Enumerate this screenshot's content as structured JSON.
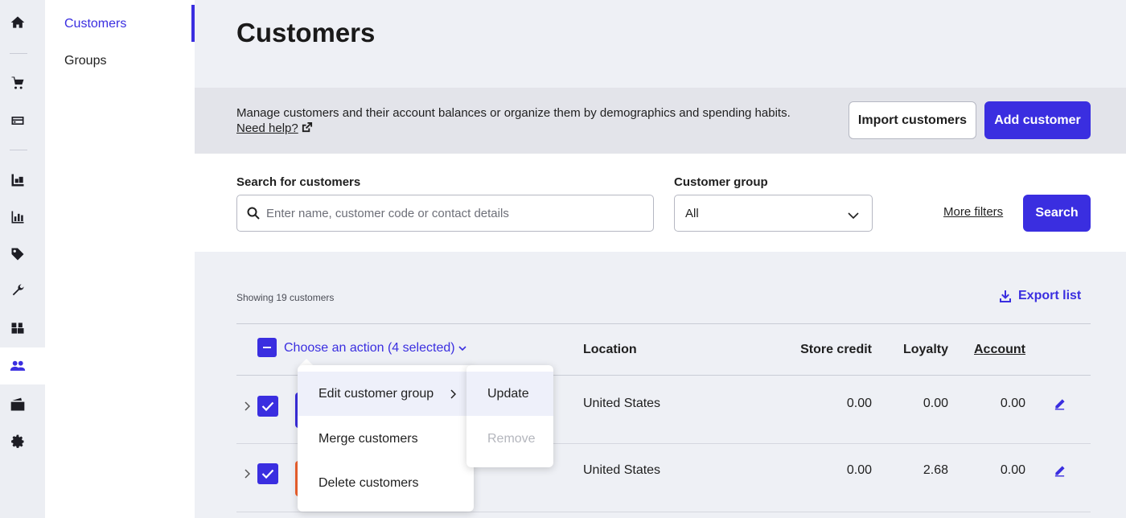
{
  "rail": {
    "icons": [
      "home-icon",
      "cart-icon",
      "register-icon",
      "inventory-icon",
      "reports-icon",
      "tag-icon",
      "wrench-icon",
      "products-icon",
      "customers-icon",
      "wallet-icon",
      "settings-icon"
    ],
    "active": "customers-icon"
  },
  "subnav": {
    "items": [
      {
        "label": "Customers",
        "active": true
      },
      {
        "label": "Groups",
        "active": false
      }
    ]
  },
  "page": {
    "title": "Customers"
  },
  "banner": {
    "description": "Manage customers and their account balances or organize them by demographics and spending habits.",
    "help_label": "Need help?",
    "import_label": "Import customers",
    "add_label": "Add customer"
  },
  "search": {
    "search_label": "Search for customers",
    "search_placeholder": "Enter name, customer code or contact details",
    "group_label": "Customer group",
    "group_value": "All",
    "more_filters_label": "More filters",
    "search_button_label": "Search"
  },
  "list": {
    "showing_text": "Showing 19 customers",
    "export_label": "Export list",
    "action_label": "Choose an action (4 selected)",
    "columns": {
      "location": "Location",
      "store_credit": "Store credit",
      "loyalty": "Loyalty",
      "account": "Account"
    },
    "rows": [
      {
        "location": "United States",
        "store_credit": "0.00",
        "loyalty": "0.00",
        "account": "0.00",
        "avatar_color": "#3a2ee0"
      },
      {
        "location": "United States",
        "store_credit": "0.00",
        "loyalty": "2.68",
        "account": "0.00",
        "avatar_color": "#f2622e"
      }
    ]
  },
  "action_menu": {
    "items": [
      "Edit customer group",
      "Merge customers",
      "Delete customers"
    ],
    "submenu": [
      "Update",
      "Remove"
    ]
  },
  "colors": {
    "accent": "#3a2ee0",
    "banner_bg": "#e3e4ea",
    "page_bg": "#eef0f5"
  }
}
